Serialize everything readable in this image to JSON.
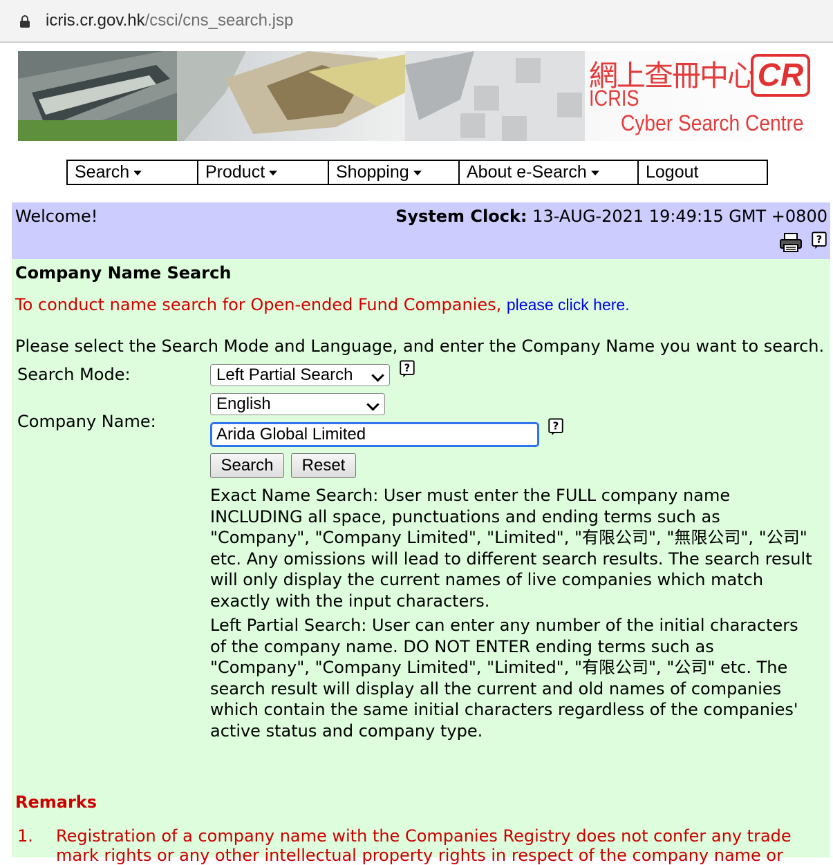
{
  "browser": {
    "url_host": "icris.cr.gov.hk",
    "url_path": "/csci/cns_search.jsp"
  },
  "banner": {
    "brand_cn": "網上查冊中心",
    "brand_icris": "ICRIS",
    "brand_cyber": "Cyber Search Centre",
    "logo_text": "CR",
    "accent_color": "#e33b3b"
  },
  "nav": {
    "items": [
      {
        "label": "Search"
      },
      {
        "label": "Product"
      },
      {
        "label": "Shopping"
      },
      {
        "label": "About e-Search"
      },
      {
        "label": "Logout"
      }
    ]
  },
  "welcome": {
    "greeting": "Welcome!",
    "clock_label": "System Clock:",
    "clock_value": "13-AUG-2021 19:49:15 GMT +0800",
    "bar_color": "#ccccff"
  },
  "form": {
    "title": "Company Name Search",
    "ofc_text": "To conduct name search for Open-ended Fund Companies, ",
    "ofc_link": "please click here.",
    "instruction": "Please select the Search Mode and Language, and enter the Company Name you want to search.",
    "search_mode_label": "Search Mode:",
    "search_mode_value": "Left Partial Search",
    "language_value": "English",
    "company_name_label": "Company Name:",
    "company_name_value": "Arida Global Limited",
    "search_button": "Search",
    "reset_button": "Reset",
    "exact_desc": "Exact Name Search: User must enter the FULL company name INCLUDING all space, punctuations and ending terms such as \"Company\", \"Company Limited\", \"Limited\", \"有限公司\", \"無限公司\", \"公司\" etc. Any omissions will lead to different search results. The search result will only display the current names of live companies which match exactly with the input characters.",
    "partial_desc": "Left Partial Search: User can enter any number of the initial characters of the company name. DO NOT ENTER ending terms such as \"Company\", \"Company Limited\", \"Limited\", \"有限公司\", \"公司\" etc. The search result will display all the current and old names of companies which contain the same initial characters regardless of the companies' active status and company type.",
    "content_color": "#ddfddd"
  },
  "remarks": {
    "title": "Remarks",
    "items": [
      {
        "num": "1.",
        "text": "Registration of a company name with the Companies Registry does not confer any trade mark rights or any other intellectual property rights in respect of the company name or"
      }
    ]
  }
}
